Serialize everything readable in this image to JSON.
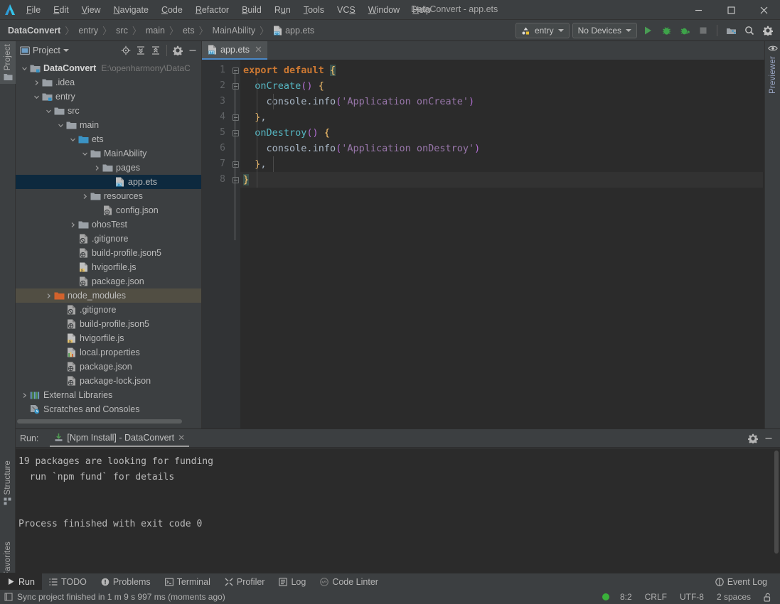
{
  "window": {
    "title": "DataConvert - app.ets",
    "controls": {
      "minimize": "—",
      "maximize": "□",
      "close": "✕"
    }
  },
  "menubar": {
    "logo_icon": "deveco-logo-icon",
    "items": [
      {
        "label": "File",
        "mnemonic": "F"
      },
      {
        "label": "Edit",
        "mnemonic": "E"
      },
      {
        "label": "View",
        "mnemonic": "V"
      },
      {
        "label": "Navigate",
        "mnemonic": "N"
      },
      {
        "label": "Code",
        "mnemonic": "C"
      },
      {
        "label": "Refactor",
        "mnemonic": "R"
      },
      {
        "label": "Build",
        "mnemonic": "B"
      },
      {
        "label": "Run",
        "mnemonic": "u"
      },
      {
        "label": "Tools",
        "mnemonic": "T"
      },
      {
        "label": "VCS",
        "mnemonic": "S"
      },
      {
        "label": "Window",
        "mnemonic": "W"
      },
      {
        "label": "Help",
        "mnemonic": "H"
      }
    ]
  },
  "breadcrumb": {
    "separator": "〉",
    "items": [
      "DataConvert",
      "entry",
      "src",
      "main",
      "ets",
      "MainAbility",
      "app.ets"
    ],
    "file_icon": "ets-file-icon"
  },
  "navbar_toolbar": {
    "run_config": {
      "label": "entry",
      "icon": "module-icon"
    },
    "device_select": {
      "label": "No Devices",
      "icon": "chevron-down-icon"
    },
    "actions": [
      {
        "name": "run-button",
        "icon": "play-icon",
        "color": "#499c54"
      },
      {
        "name": "debug-button",
        "icon": "bug-icon",
        "color": "#43a047"
      },
      {
        "name": "attach-debugger-button",
        "icon": "attach-debug-icon",
        "color": "#43a047"
      },
      {
        "name": "stop-button",
        "icon": "stop-icon",
        "color": "#7a7a7a"
      },
      {
        "name": "project-structure-button",
        "icon": "project-structure-icon",
        "color": "#8ab4dd"
      },
      {
        "name": "search-everywhere-button",
        "icon": "search-icon",
        "color": "#c0c0c0"
      },
      {
        "name": "settings-button",
        "icon": "gear-icon",
        "color": "#c0c0c0"
      }
    ]
  },
  "left_strip": {
    "tabs": [
      {
        "label": "Project",
        "icon": "folder-icon",
        "active": true
      }
    ],
    "bottom_tabs": [
      {
        "label": "Structure",
        "icon": "structure-icon"
      },
      {
        "label": "Favorites",
        "icon": "star-icon"
      }
    ]
  },
  "right_strip": {
    "tabs": [
      {
        "label": "Previewer",
        "icon": "eye-icon"
      }
    ]
  },
  "project_panel": {
    "title": "Project",
    "title_icon": "project-view-icon",
    "dropdown_icon": "chevron-down-icon",
    "actions": [
      {
        "name": "select-opened-file-button",
        "icon": "locate-target-icon"
      },
      {
        "name": "expand-all-button",
        "icon": "expand-all-icon"
      },
      {
        "name": "collapse-all-button",
        "icon": "collapse-all-icon"
      },
      {
        "name": "panel-settings-button",
        "icon": "gear-icon"
      },
      {
        "name": "hide-panel-button",
        "icon": "minimize-icon"
      }
    ],
    "tree": [
      {
        "label": "DataConvert",
        "path": "E:\\openharmony\\DataC",
        "depth": 0,
        "arrow": "down",
        "icon": "module-folder-icon",
        "bold": true,
        "state": "normal"
      },
      {
        "label": ".idea",
        "depth": 1,
        "arrow": "right",
        "icon": "folder-icon",
        "state": "normal"
      },
      {
        "label": "entry",
        "depth": 1,
        "arrow": "down",
        "icon": "module-folder-icon",
        "state": "normal"
      },
      {
        "label": "src",
        "depth": 2,
        "arrow": "down",
        "icon": "folder-icon",
        "state": "normal"
      },
      {
        "label": "main",
        "depth": 3,
        "arrow": "down",
        "icon": "folder-icon",
        "state": "normal"
      },
      {
        "label": "ets",
        "depth": 4,
        "arrow": "down",
        "icon": "source-folder-icon",
        "state": "normal"
      },
      {
        "label": "MainAbility",
        "depth": 5,
        "arrow": "down",
        "icon": "folder-icon",
        "state": "normal"
      },
      {
        "label": "pages",
        "depth": 6,
        "arrow": "right",
        "icon": "folder-icon",
        "state": "normal"
      },
      {
        "label": "app.ets",
        "depth": 7,
        "arrow": "none",
        "icon": "ets-file-icon",
        "state": "selected"
      },
      {
        "label": "resources",
        "depth": 5,
        "arrow": "right",
        "icon": "folder-icon",
        "state": "normal"
      },
      {
        "label": "config.json",
        "depth": 6,
        "arrow": "none",
        "icon": "json-file-icon",
        "state": "normal"
      },
      {
        "label": "ohosTest",
        "depth": 4,
        "arrow": "right",
        "icon": "folder-icon",
        "state": "normal"
      },
      {
        "label": ".gitignore",
        "depth": 4,
        "arrow": "none",
        "icon": "gitignore-file-icon",
        "state": "normal"
      },
      {
        "label": "build-profile.json5",
        "depth": 4,
        "arrow": "none",
        "icon": "json-file-icon",
        "state": "normal"
      },
      {
        "label": "hvigorfile.js",
        "depth": 4,
        "arrow": "none",
        "icon": "js-file-icon",
        "state": "normal"
      },
      {
        "label": "package.json",
        "depth": 4,
        "arrow": "none",
        "icon": "json-file-icon",
        "state": "normal"
      },
      {
        "label": "node_modules",
        "depth": 2,
        "arrow": "right",
        "icon": "excluded-folder-icon",
        "state": "hovered"
      },
      {
        "label": ".gitignore",
        "depth": 3,
        "arrow": "none",
        "icon": "gitignore-file-icon",
        "state": "normal"
      },
      {
        "label": "build-profile.json5",
        "depth": 3,
        "arrow": "none",
        "icon": "json-file-icon",
        "state": "normal"
      },
      {
        "label": "hvigorfile.js",
        "depth": 3,
        "arrow": "none",
        "icon": "js-file-icon",
        "state": "normal"
      },
      {
        "label": "local.properties",
        "depth": 3,
        "arrow": "none",
        "icon": "properties-file-icon",
        "state": "normal"
      },
      {
        "label": "package.json",
        "depth": 3,
        "arrow": "none",
        "icon": "json-file-icon",
        "state": "normal"
      },
      {
        "label": "package-lock.json",
        "depth": 3,
        "arrow": "none",
        "icon": "json-file-icon",
        "state": "normal"
      },
      {
        "label": "External Libraries",
        "depth": 0,
        "arrow": "right",
        "icon": "libraries-icon",
        "state": "normal"
      },
      {
        "label": "Scratches and Consoles",
        "depth": 0,
        "arrow": "none",
        "icon": "scratches-icon",
        "state": "normal"
      }
    ]
  },
  "editor": {
    "tabs": [
      {
        "label": "app.ets",
        "icon": "ets-file-icon",
        "active": true,
        "close_icon": "close-icon"
      }
    ],
    "line_numbers": [
      "1",
      "2",
      "3",
      "4",
      "5",
      "6",
      "7",
      "8"
    ],
    "code_lines": [
      {
        "n": 1,
        "tokens": [
          {
            "t": "export default ",
            "c": "kw"
          },
          {
            "t": "{",
            "c": "brace-hl"
          }
        ]
      },
      {
        "n": 2,
        "tokens": [
          {
            "t": "  ",
            "c": "punct"
          },
          {
            "t": "onCreate",
            "c": "fn"
          },
          {
            "t": "()",
            "c": "paren"
          },
          {
            "t": " ",
            "c": "punct"
          },
          {
            "t": "{",
            "c": "brace"
          }
        ]
      },
      {
        "n": 3,
        "tokens": [
          {
            "t": "    ",
            "c": "punct"
          },
          {
            "t": "console",
            "c": "obj"
          },
          {
            "t": ".",
            "c": "punct"
          },
          {
            "t": "info",
            "c": "obj"
          },
          {
            "t": "(",
            "c": "paren"
          },
          {
            "t": "'Application onCreate'",
            "c": "str"
          },
          {
            "t": ")",
            "c": "paren"
          }
        ]
      },
      {
        "n": 4,
        "tokens": [
          {
            "t": "  ",
            "c": "punct"
          },
          {
            "t": "}",
            "c": "brace"
          },
          {
            "t": ",",
            "c": "punct"
          }
        ]
      },
      {
        "n": 5,
        "tokens": [
          {
            "t": "  ",
            "c": "punct"
          },
          {
            "t": "onDestroy",
            "c": "fn"
          },
          {
            "t": "()",
            "c": "paren"
          },
          {
            "t": " ",
            "c": "punct"
          },
          {
            "t": "{",
            "c": "brace"
          }
        ]
      },
      {
        "n": 6,
        "tokens": [
          {
            "t": "    ",
            "c": "punct"
          },
          {
            "t": "console",
            "c": "obj"
          },
          {
            "t": ".",
            "c": "punct"
          },
          {
            "t": "info",
            "c": "obj"
          },
          {
            "t": "(",
            "c": "paren"
          },
          {
            "t": "'Application onDestroy'",
            "c": "str"
          },
          {
            "t": ")",
            "c": "paren"
          }
        ]
      },
      {
        "n": 7,
        "tokens": [
          {
            "t": "  ",
            "c": "punct"
          },
          {
            "t": "}",
            "c": "brace"
          },
          {
            "t": ",",
            "c": "punct"
          }
        ]
      },
      {
        "n": 8,
        "tokens": [
          {
            "t": "}",
            "c": "brace-hl"
          }
        ]
      }
    ],
    "current_line": 8,
    "inspection_status": {
      "icon": "checkmark-icon",
      "color": "#59a869"
    },
    "fold_markers": [
      {
        "line": 1,
        "type": "open"
      },
      {
        "line": 2,
        "type": "open"
      },
      {
        "line": 4,
        "type": "close"
      },
      {
        "line": 5,
        "type": "open"
      },
      {
        "line": 7,
        "type": "close"
      },
      {
        "line": 8,
        "type": "close"
      }
    ]
  },
  "run_panel": {
    "label": "Run:",
    "tab": {
      "label": "[Npm Install] - DataConvert",
      "icon": "npm-install-icon",
      "close_icon": "close-icon"
    },
    "actions": [
      {
        "name": "run-panel-settings-button",
        "icon": "gear-icon"
      },
      {
        "name": "hide-run-panel-button",
        "icon": "minimize-icon"
      }
    ],
    "console_lines": [
      "19 packages are looking for funding",
      "  run `npm fund` for details",
      "",
      "",
      "Process finished with exit code 0"
    ]
  },
  "bottom_bar": {
    "items": [
      {
        "label": "Run",
        "icon": "play-icon",
        "active": true
      },
      {
        "label": "TODO",
        "icon": "todo-list-icon",
        "active": false
      },
      {
        "label": "Problems",
        "icon": "problems-icon",
        "active": false
      },
      {
        "label": "Terminal",
        "icon": "terminal-icon",
        "active": false
      },
      {
        "label": "Profiler",
        "icon": "profiler-icon",
        "active": false
      },
      {
        "label": "Log",
        "icon": "log-icon",
        "active": false
      },
      {
        "label": "Code Linter",
        "icon": "code-linter-icon",
        "active": false
      }
    ],
    "right": {
      "label": "Event Log",
      "icon": "event-log-icon"
    }
  },
  "status_bar": {
    "left": {
      "icon": "window-toggle-icon",
      "message": "Sync project finished in 1 m 9 s 997 ms (moments ago)"
    },
    "right": {
      "indicator_color": "#3ab03a",
      "caret_position": "8:2",
      "line_separator": "CRLF",
      "encoding": "UTF-8",
      "indent": "2 spaces",
      "lock_icon": "unlocked-icon"
    }
  },
  "colors": {
    "chrome": "#3c3f41",
    "editor_bg": "#2b2b2b",
    "gutter_bg": "#313335",
    "selection": "#0d293e",
    "hover_row": "#514e43",
    "tab_underline": "#4a88c7",
    "accent_green": "#499c54"
  }
}
